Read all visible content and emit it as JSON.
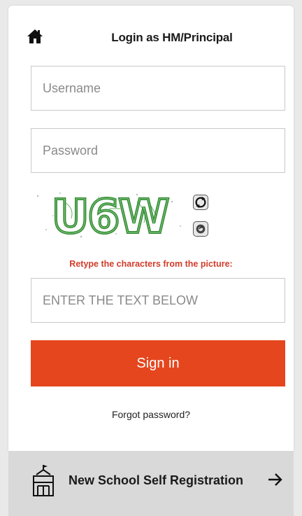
{
  "header": {
    "home_icon": "home-icon",
    "title": "Login as HM/Principal"
  },
  "form": {
    "username_placeholder": "Username",
    "password_placeholder": "Password",
    "captcha": {
      "text": "U6W",
      "refresh_icon": "refresh-icon",
      "audio_icon": "audio-icon",
      "hint": "Retype the characters from the picture:",
      "input_placeholder": "ENTER THE TEXT BELOW"
    },
    "signin_label": "Sign in",
    "forgot_label": "Forgot password?"
  },
  "registration": {
    "icon": "school-building-icon",
    "label": "New School Self Registration",
    "arrow_icon": "arrow-right-icon"
  },
  "colors": {
    "accent": "#e5461d",
    "hint": "#d23c2a",
    "captcha_green": "#2f8a2f",
    "reg_bar_bg": "#d9d9d9"
  }
}
